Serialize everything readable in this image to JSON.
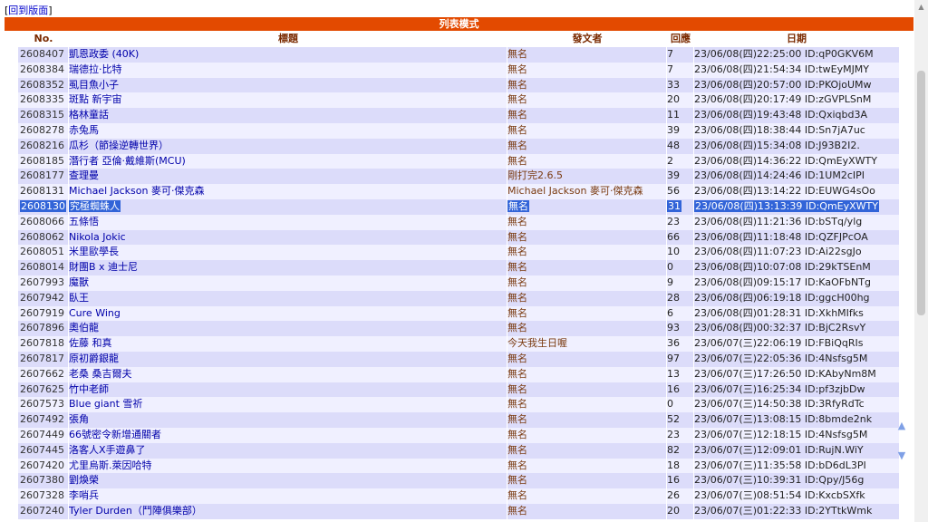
{
  "nav": {
    "bracket_open": "[",
    "back_label": "回到版面",
    "bracket_close": "]"
  },
  "title_bar": "列表模式",
  "headers": {
    "no": "No.",
    "title": "標題",
    "author": "發文者",
    "replies": "回應",
    "date": "日期"
  },
  "rows": [
    {
      "no": "2608407",
      "title": "凱恩政委 (40K)",
      "author": "無名",
      "replies": "7",
      "date": "23/06/08(四)22:25:00 ID:qP0GKV6M"
    },
    {
      "no": "2608384",
      "title": "瑞德拉·比特",
      "author": "無名",
      "replies": "7",
      "date": "23/06/08(四)21:54:34 ID:twEyMJMY"
    },
    {
      "no": "2608352",
      "title": "虱目魚小子",
      "author": "無名",
      "replies": "33",
      "date": "23/06/08(四)20:57:00 ID:PKOjoUMw"
    },
    {
      "no": "2608335",
      "title": "斑點 新宇宙",
      "author": "無名",
      "replies": "20",
      "date": "23/06/08(四)20:17:49 ID:zGVPLSnM"
    },
    {
      "no": "2608315",
      "title": "格林童話",
      "author": "無名",
      "replies": "11",
      "date": "23/06/08(四)19:43:48 ID:Qxiqbd3A"
    },
    {
      "no": "2608278",
      "title": "赤兔馬",
      "author": "無名",
      "replies": "39",
      "date": "23/06/08(四)18:38:44 ID:Sn7jA7uc"
    },
    {
      "no": "2608216",
      "title": "瓜杉（節操逆轉世界）",
      "author": "無名",
      "replies": "48",
      "date": "23/06/08(四)15:34:08 ID:J93B2I2."
    },
    {
      "no": "2608185",
      "title": "潛行者 亞倫·戴維斯(MCU)",
      "author": "無名",
      "replies": "2",
      "date": "23/06/08(四)14:36:22 ID:QmEyXWTY"
    },
    {
      "no": "2608177",
      "title": "查理曼",
      "author": "剛打完2.6.5",
      "replies": "39",
      "date": "23/06/08(四)14:24:46 ID:1UM2cIPI"
    },
    {
      "no": "2608131",
      "title": "Michael Jackson 麥可·傑克森",
      "author": "Michael Jackson 麥可·傑克森",
      "replies": "56",
      "date": "23/06/08(四)13:14:22 ID:EUWG4sOo"
    },
    {
      "no": "2608130",
      "title": "究極蜘蛛人",
      "author": "無名",
      "replies": "31",
      "date": "23/06/08(四)13:13:39 ID:QmEyXWTY",
      "selected": true
    },
    {
      "no": "2608066",
      "title": "五條悟",
      "author": "無名",
      "replies": "23",
      "date": "23/06/08(四)11:21:36 ID:bSTq/ylg"
    },
    {
      "no": "2608062",
      "title": "Nikola Jokic",
      "author": "無名",
      "replies": "66",
      "date": "23/06/08(四)11:18:48 ID:QZFJPcOA"
    },
    {
      "no": "2608051",
      "title": "米里歐學長",
      "author": "無名",
      "replies": "10",
      "date": "23/06/08(四)11:07:23 ID:Ai22sgJo"
    },
    {
      "no": "2608014",
      "title": "財團B x 迪士尼",
      "author": "無名",
      "replies": "0",
      "date": "23/06/08(四)10:07:08 ID:29kTSEnM"
    },
    {
      "no": "2607993",
      "title": "魔獸",
      "author": "無名",
      "replies": "9",
      "date": "23/06/08(四)09:15:17 ID:KaOFbNTg"
    },
    {
      "no": "2607942",
      "title": "臥王",
      "author": "無名",
      "replies": "28",
      "date": "23/06/08(四)06:19:18 ID:ggcH00hg"
    },
    {
      "no": "2607919",
      "title": "Cure Wing",
      "author": "無名",
      "replies": "6",
      "date": "23/06/08(四)01:28:31 ID:XkhMIfks"
    },
    {
      "no": "2607896",
      "title": "奧伯龍",
      "author": "無名",
      "replies": "93",
      "date": "23/06/08(四)00:32:37 ID:BjC2RsvY"
    },
    {
      "no": "2607818",
      "title": "佐藤 和真",
      "author": "今天我生日喔",
      "replies": "36",
      "date": "23/06/07(三)22:06:19 ID:FBiQqRIs"
    },
    {
      "no": "2607817",
      "title": "原初爵銀龍",
      "author": "無名",
      "replies": "97",
      "date": "23/06/07(三)22:05:36 ID:4Nsfsg5M"
    },
    {
      "no": "2607662",
      "title": "老桑 桑吉爾夫",
      "author": "無名",
      "replies": "13",
      "date": "23/06/07(三)17:26:50 ID:KAbyNm8M"
    },
    {
      "no": "2607625",
      "title": "竹中老師",
      "author": "無名",
      "replies": "16",
      "date": "23/06/07(三)16:25:34 ID:pf3zjbDw"
    },
    {
      "no": "2607573",
      "title": "Blue giant 雪祈",
      "author": "無名",
      "replies": "0",
      "date": "23/06/07(三)14:50:38 ID:3RfyRdTc"
    },
    {
      "no": "2607492",
      "title": "張角",
      "author": "無名",
      "replies": "52",
      "date": "23/06/07(三)13:08:15 ID:8bmde2nk"
    },
    {
      "no": "2607449",
      "title": "66號密令新增通關者",
      "author": "無名",
      "replies": "23",
      "date": "23/06/07(三)12:18:15 ID:4Nsfsg5M"
    },
    {
      "no": "2607445",
      "title": "洛客人X手遊鼻了",
      "author": "無名",
      "replies": "82",
      "date": "23/06/07(三)12:09:01 ID:RujN.WiY"
    },
    {
      "no": "2607420",
      "title": "尤里烏斯.萊因哈特",
      "author": "無名",
      "replies": "18",
      "date": "23/06/07(三)11:35:58 ID:bD6dL3PI"
    },
    {
      "no": "2607380",
      "title": "劉煥榮",
      "author": "無名",
      "replies": "16",
      "date": "23/06/07(三)10:39:31 ID:Qpy/J56g"
    },
    {
      "no": "2607328",
      "title": "李哨兵",
      "author": "無名",
      "replies": "26",
      "date": "23/06/07(三)08:51:54 ID:KxcbSXfk"
    },
    {
      "no": "2607240",
      "title": "Tyler Durden（鬥陣俱樂部）",
      "author": "無名",
      "replies": "20",
      "date": "23/06/07(三)01:22:33 ID:2YTtkWmk"
    }
  ],
  "icons": {
    "page_up": "triangle-up",
    "page_down": "triangle-down",
    "accent": "#e34a00",
    "row_odd": "#dcdcfa",
    "row_even": "#f0f0ff",
    "selected": "#3264d8"
  }
}
